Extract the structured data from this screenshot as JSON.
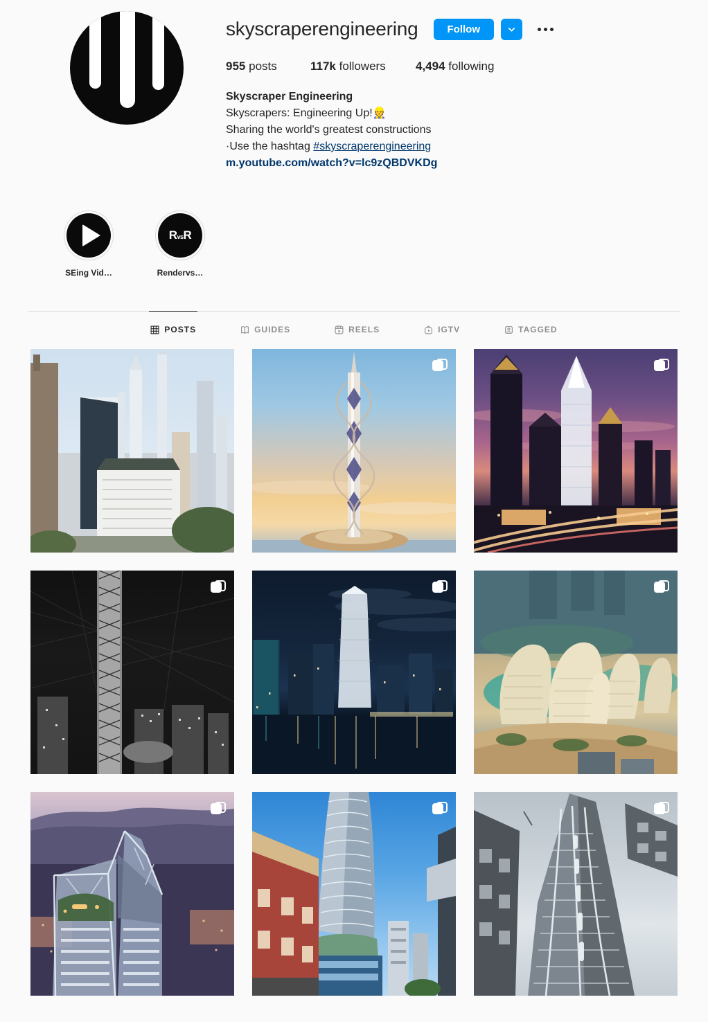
{
  "profile": {
    "username": "skyscraperengineering",
    "avatar_icon": "skyscraper-logo",
    "follow_label": "Follow",
    "dropdown_icon": "chevron-down-icon",
    "options_icon": "ellipsis-icon",
    "stats": [
      {
        "value": "955",
        "label": "posts"
      },
      {
        "value": "117k",
        "label": "followers"
      },
      {
        "value": "4,494",
        "label": "following"
      }
    ],
    "bio": {
      "full_name": "Skyscraper Engineering",
      "line1": "Skyscrapers: Engineering Up!👷",
      "line2": "Sharing the world's greatest constructions",
      "line3_prefix": "·Use the hashtag ",
      "line3_hashtag": "#skyscraperengineering",
      "link": "m.youtube.com/watch?v=lc9zQBDVKDg"
    }
  },
  "highlights": [
    {
      "label": "SEing Vid…",
      "cover_icon": "play-icon"
    },
    {
      "label": "Rendervs…",
      "cover_icon": "r-vs-r-text"
    }
  ],
  "tabs": [
    {
      "label": "POSTS",
      "icon": "grid-icon",
      "active": true
    },
    {
      "label": "GUIDES",
      "icon": "guides-icon",
      "active": false
    },
    {
      "label": "REELS",
      "icon": "reels-icon",
      "active": false
    },
    {
      "label": "IGTV",
      "icon": "igtv-icon",
      "active": false
    },
    {
      "label": "TAGGED",
      "icon": "tagged-icon",
      "active": false
    }
  ],
  "posts": [
    {
      "art": "a1",
      "alt": "daytime midtown manhattan skyline with supertall towers",
      "multi": false
    },
    {
      "art": "a2",
      "alt": "spiral twisting supertall tower at sunset over water",
      "multi": true
    },
    {
      "art": "a3",
      "alt": "purple twilight downtown skyline with freeway light trails",
      "multi": true
    },
    {
      "art": "a4",
      "alt": "black and white aerial night view of braced skyscraper",
      "multi": true
    },
    {
      "art": "a5",
      "alt": "waterfront city skyline at night with reflections",
      "multi": true
    },
    {
      "art": "a6",
      "alt": "futuristic curved cream towers over teal lagoon",
      "multi": true
    },
    {
      "art": "a7",
      "alt": "dusk tower with sky garden and mountain backdrop",
      "multi": true
    },
    {
      "art": "a8",
      "alt": "curved silver tower against blue sky with brick building",
      "multi": true
    },
    {
      "art": "a9",
      "alt": "upward view of faceted tower against grey sky",
      "multi": true
    }
  ],
  "colors": {
    "accent": "#0095f6",
    "link": "#00376b",
    "text": "#262626",
    "muted": "#8e8e8e",
    "background": "#fafafa",
    "border": "#dbdbdb"
  }
}
